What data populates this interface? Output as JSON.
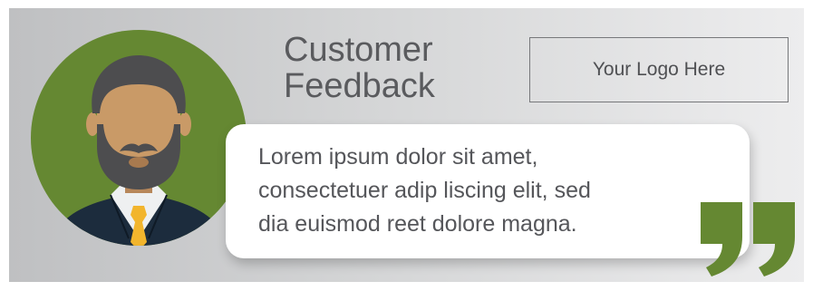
{
  "header": {
    "title_line1": "Customer",
    "title_line2": "Feedback"
  },
  "logo": {
    "label": "Your Logo Here"
  },
  "testimonial": {
    "lines": [
      "Lorem ipsum dolor sit amet,",
      "consectetuer adip liscing elit, sed",
      "dia euismod reet dolore magna."
    ]
  },
  "icons": {
    "avatar": "bearded-man-avatar-icon",
    "quote": "closing-quote-icon"
  },
  "colors": {
    "accent_green": "#658832",
    "text_gray": "#5a5b5e",
    "tie_yellow": "#f2b52d",
    "suit_navy": "#1c2c3d",
    "skin": "#c99a67",
    "hair": "#4d4d4f"
  }
}
